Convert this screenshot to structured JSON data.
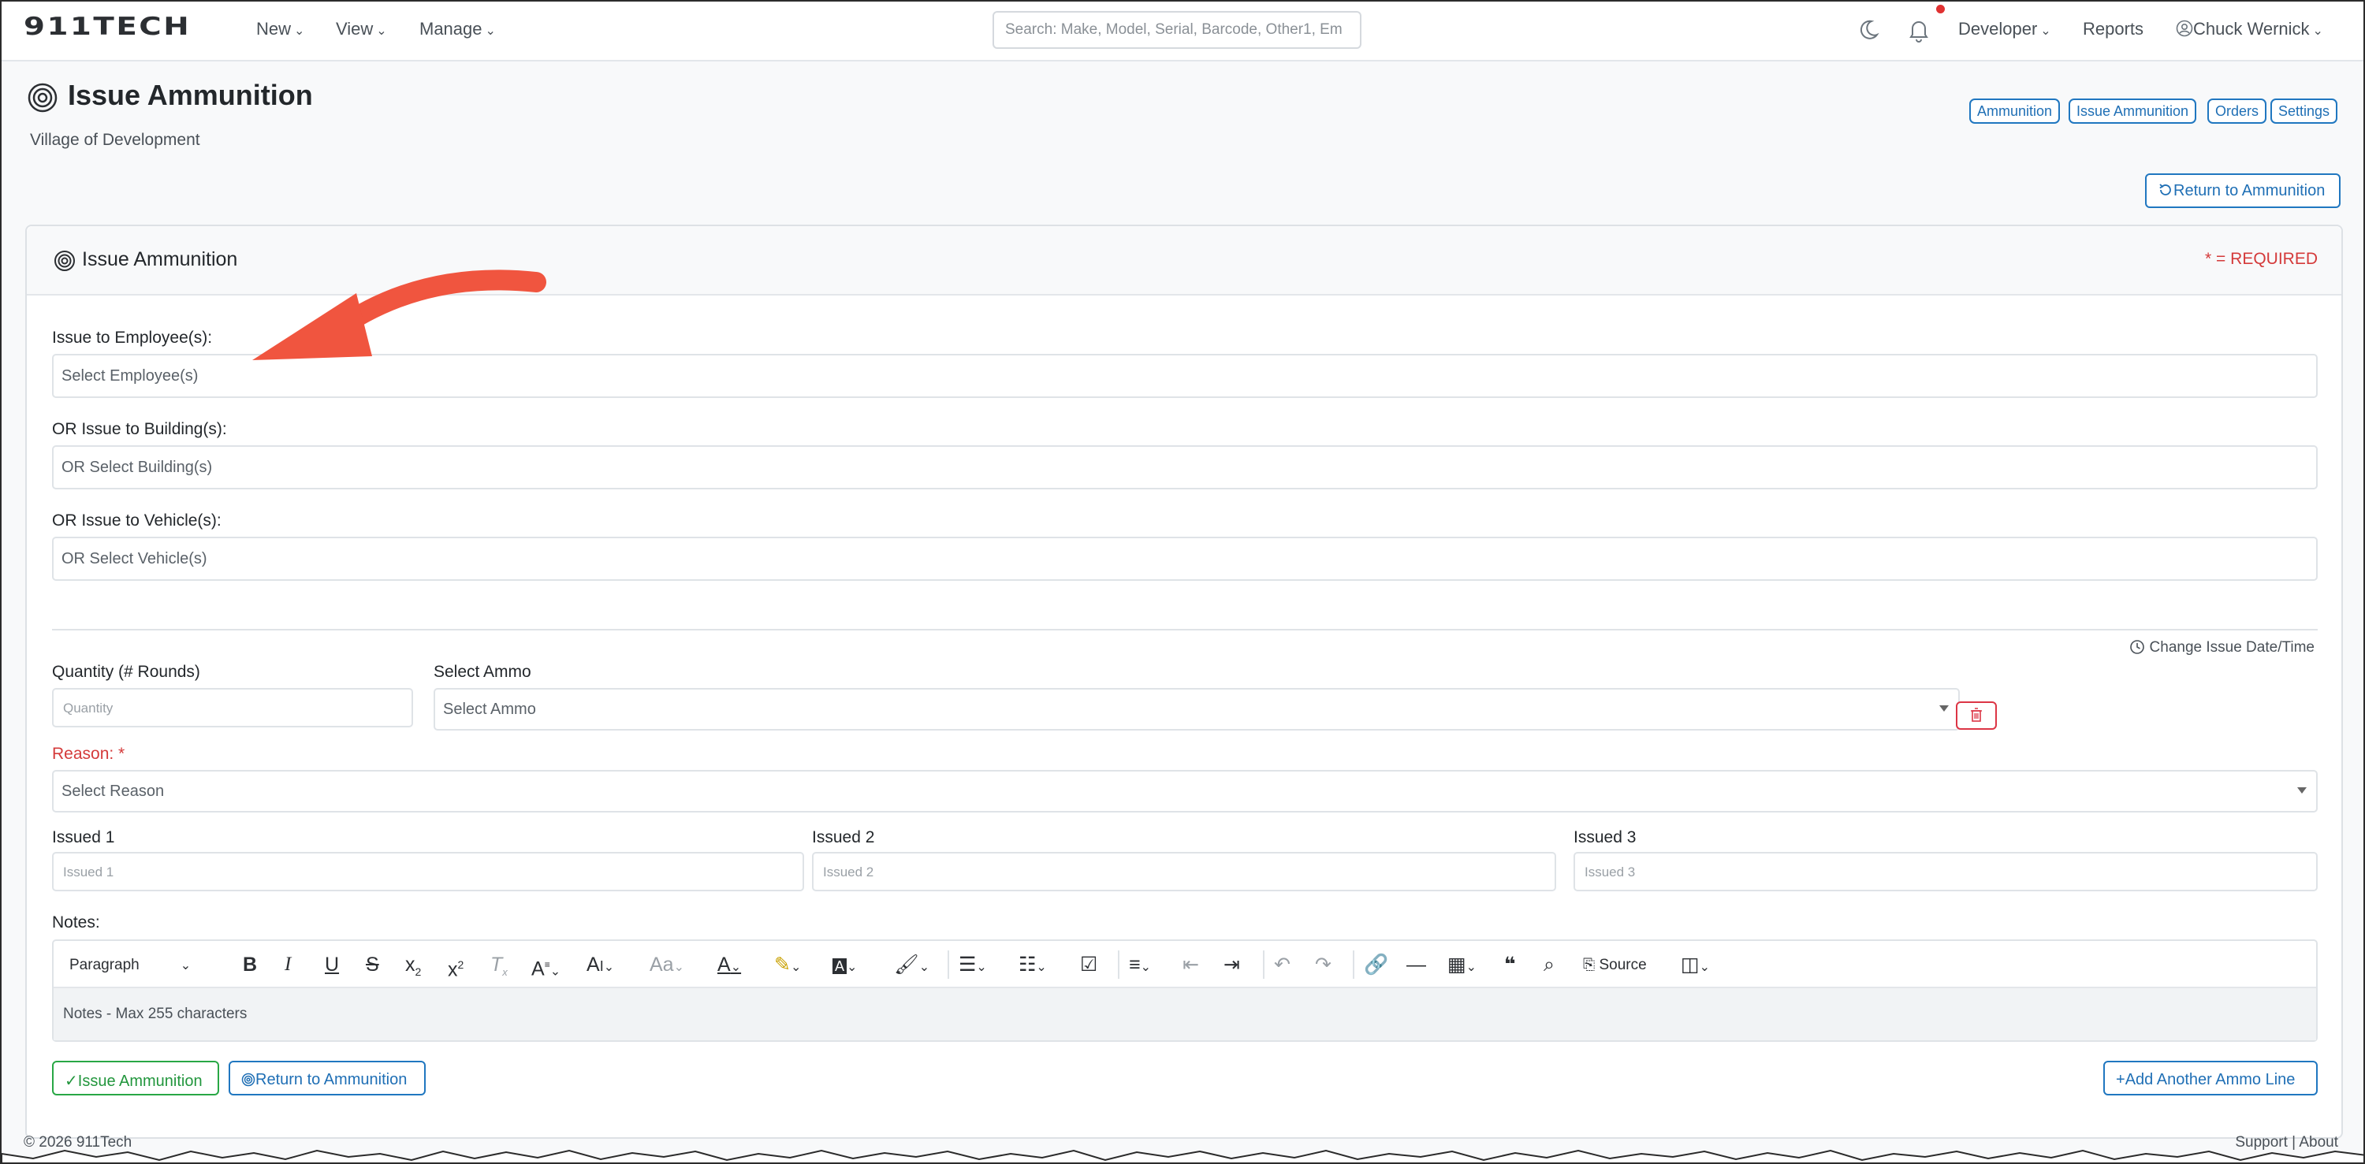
{
  "navbar": {
    "brand": "911TECH",
    "menus": [
      "New",
      "View",
      "Manage"
    ],
    "search_placeholder": "Search: Make, Model, Serial, Barcode, Other1, Em",
    "right_menus": [
      "Developer"
    ],
    "reports": "Reports",
    "user": "Chuck Wernick",
    "icons": [
      "moon-icon",
      "bell-icon",
      "user-circle-icon"
    ]
  },
  "header": {
    "title": "Issue Ammunition",
    "subtitle": "Village of Development",
    "pills": [
      "Ammunition",
      "Issue Ammunition",
      "Orders",
      "Settings"
    ],
    "return_button": "Return to Ammunition"
  },
  "card": {
    "title": "Issue Ammunition",
    "required_note": "* = REQUIRED",
    "employee_label": "Issue to Employee(s):",
    "employee_placeholder": "Select Employee(s)",
    "building_label": "OR Issue to Building(s):",
    "building_placeholder": "OR Select Building(s)",
    "vehicle_label": "OR Issue to Vehicle(s):",
    "vehicle_placeholder": "OR Select Vehicle(s)",
    "change_date": "Change Issue Date/Time",
    "quantity_label": "Quantity (# Rounds)",
    "quantity_placeholder": "Quantity",
    "ammo_label": "Select Ammo",
    "ammo_placeholder": "Select Ammo",
    "reason_label": "Reason: *",
    "reason_placeholder": "Select Reason",
    "issued1_label": "Issued 1",
    "issued1_placeholder": "Issued 1",
    "issued2_label": "Issued 2",
    "issued2_placeholder": "Issued 2",
    "issued3_label": "Issued 3",
    "issued3_placeholder": "Issued 3",
    "notes_label": "Notes:",
    "editor_paragraph": "Paragraph",
    "editor_source": "Source",
    "notes_placeholder": "Notes - Max 255 characters",
    "issue_button": "Issue Ammunition",
    "return_button": "Return to Ammunition",
    "add_line_button": "Add Another Ammo Line"
  },
  "footer": {
    "copyright": "© 2026 911Tech",
    "links": "Support | About"
  },
  "colors": {
    "primary": "#1f6fb5",
    "success": "#28a745",
    "danger": "#d43a3a",
    "annotation": "#f0553f"
  }
}
